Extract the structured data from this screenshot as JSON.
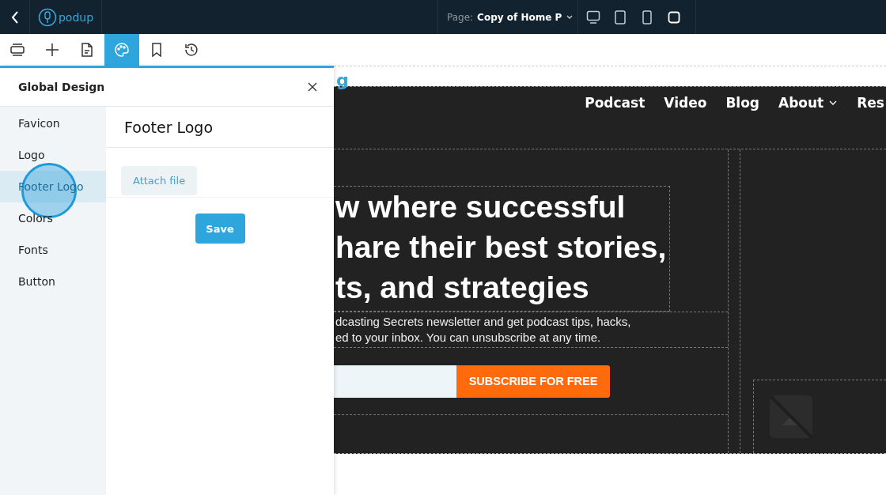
{
  "top_bar": {
    "logo_text": "podup",
    "page_label": "Page:",
    "page_name": "Copy of Home P"
  },
  "toolbar": [
    {
      "kind": "layers",
      "selected": false
    },
    {
      "kind": "add",
      "selected": false
    },
    {
      "kind": "page",
      "selected": false
    },
    {
      "kind": "palette",
      "selected": true
    },
    {
      "kind": "bookmark",
      "selected": false
    },
    {
      "kind": "history",
      "selected": false
    }
  ],
  "panel": {
    "title": "Global Design",
    "nav": [
      {
        "label": "Favicon",
        "selected": false
      },
      {
        "label": "Logo",
        "selected": false
      },
      {
        "label": "Footer Logo",
        "selected": true
      },
      {
        "label": "Colors",
        "selected": false
      },
      {
        "label": "Fonts",
        "selected": false
      },
      {
        "label": "Button",
        "selected": false
      }
    ],
    "section_title": "Footer Logo",
    "attach_button": "Attach file",
    "save_button": "Save"
  },
  "preview": {
    "logo_fragment": "g",
    "nav": [
      {
        "label": "Podcast",
        "dropdown": false
      },
      {
        "label": "Video",
        "dropdown": false
      },
      {
        "label": "Blog",
        "dropdown": false
      },
      {
        "label": "About",
        "dropdown": true
      },
      {
        "label": "Res",
        "dropdown": false
      }
    ],
    "heading_lines": [
      "w where successful",
      "hare their best stories,",
      "ts, and strategies"
    ],
    "paragraph_lines": [
      "dcasting Secrets newsletter and get podcast tips, hacks,",
      "ed to your inbox. You can unsubscribe at any time."
    ],
    "subscribe_button": "SUBSCRIBE FOR FREE"
  }
}
